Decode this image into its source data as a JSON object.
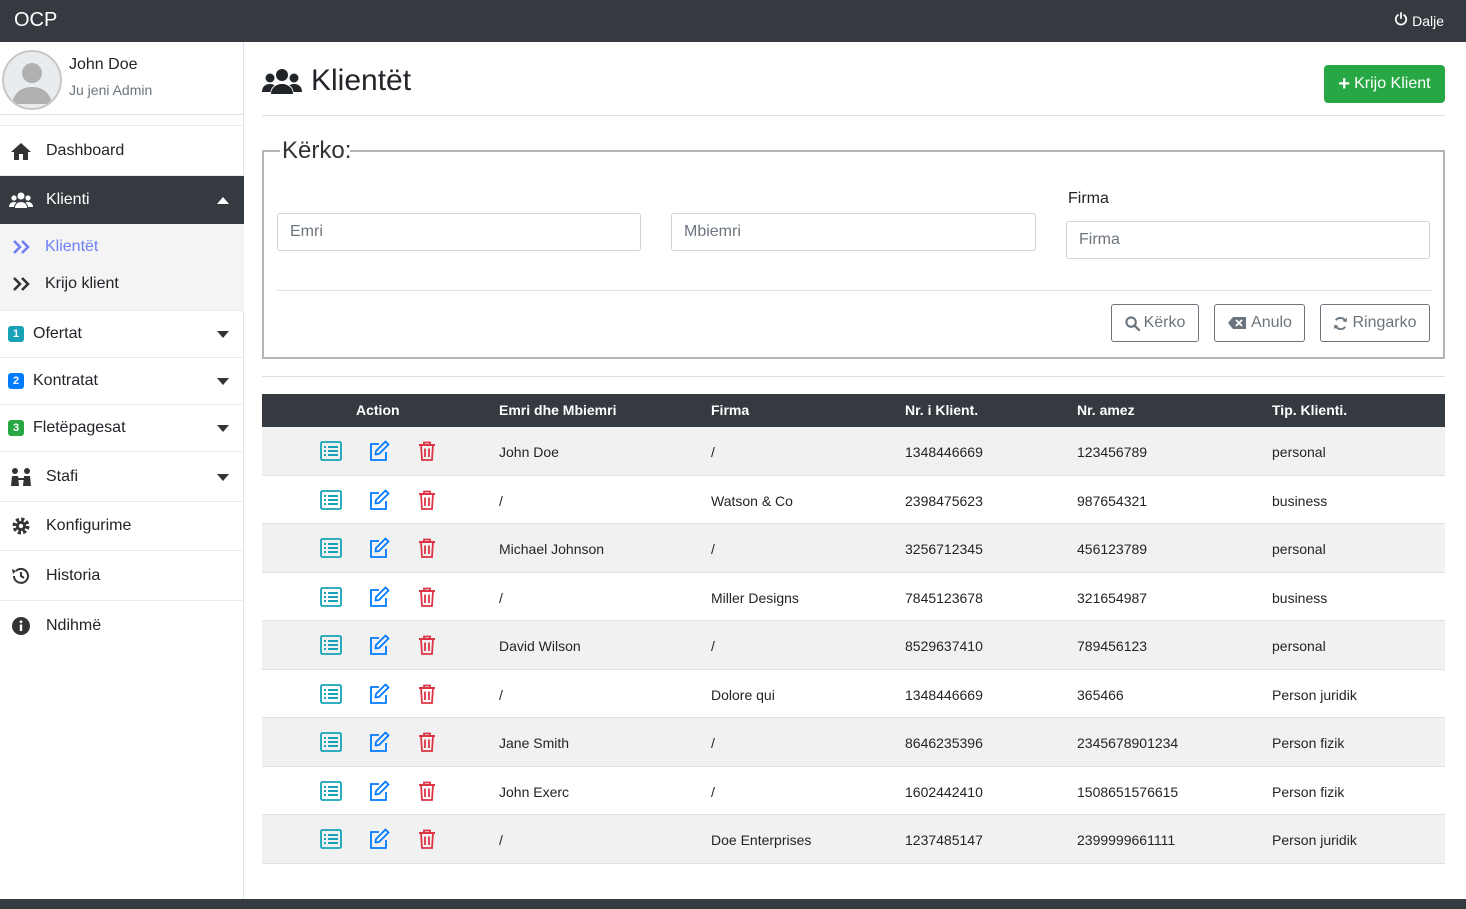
{
  "topbar": {
    "brand": "OCP",
    "logout_label": "Dalje"
  },
  "user": {
    "name": "John Doe",
    "role": "Ju jeni Admin"
  },
  "sidebar": {
    "items": [
      {
        "label": "Dashboard",
        "icon": "home-icon"
      },
      {
        "label": "Klienti",
        "icon": "users-icon",
        "active": true
      },
      {
        "label": "Ofertat",
        "badge": "1",
        "badge_color": "#17a2b8"
      },
      {
        "label": "Kontratat",
        "badge": "2",
        "badge_color": "#007bff"
      },
      {
        "label": "Fletëpagesat",
        "badge": "3",
        "badge_color": "#28a745"
      },
      {
        "label": "Stafi",
        "icon": "staff-icon"
      },
      {
        "label": "Konfigurime",
        "icon": "gear-icon"
      },
      {
        "label": "Historia",
        "icon": "history-icon"
      },
      {
        "label": "Ndihmë",
        "icon": "info-icon"
      }
    ],
    "subitems": [
      {
        "label": "Klientët",
        "active": true
      },
      {
        "label": "Krijo klient"
      }
    ]
  },
  "page": {
    "title": "Klientët",
    "create_button": "Krijo Klient"
  },
  "search": {
    "legend": "Kërko:",
    "firma_label": "Firma",
    "emri_placeholder": "Emri",
    "mbiemri_placeholder": "Mbiemri",
    "firma_placeholder": "Firma",
    "search_button": "Kërko",
    "cancel_button": "Anulo",
    "reload_button": "Ringarko"
  },
  "table": {
    "headers": [
      "Action",
      "Emri dhe Mbiemri",
      "Firma",
      "Nr. i Klient.",
      "Nr. amez",
      "Tip. Klienti."
    ],
    "rows": [
      [
        "John Doe",
        "/",
        "1348446669",
        "123456789",
        "personal"
      ],
      [
        "/",
        "Watson & Co",
        "2398475623",
        "987654321",
        "business"
      ],
      [
        "Michael Johnson",
        "/",
        "3256712345",
        "456123789",
        "personal"
      ],
      [
        "/",
        "Miller Designs",
        "7845123678",
        "321654987",
        "business"
      ],
      [
        "David Wilson",
        "/",
        "8529637410",
        "789456123",
        "personal"
      ],
      [
        "/",
        "Dolore qui",
        "1348446669",
        "365466",
        "Person juridik"
      ],
      [
        "Jane Smith",
        "/",
        "8646235396",
        "2345678901234",
        "Person fizik"
      ],
      [
        "John Exerc",
        "/",
        "1602442410",
        "1508651576615",
        "Person fizik"
      ],
      [
        "/",
        "Doe Enterprises",
        "1237485147",
        "2399999661111",
        "Person juridik"
      ]
    ]
  },
  "colors": {
    "dark": "#343a40",
    "success": "#28a745",
    "view_icon": "#17a2b8",
    "edit_icon": "#007bff",
    "delete_icon": "#dc3545",
    "active_sub": "#6f7ff5"
  }
}
